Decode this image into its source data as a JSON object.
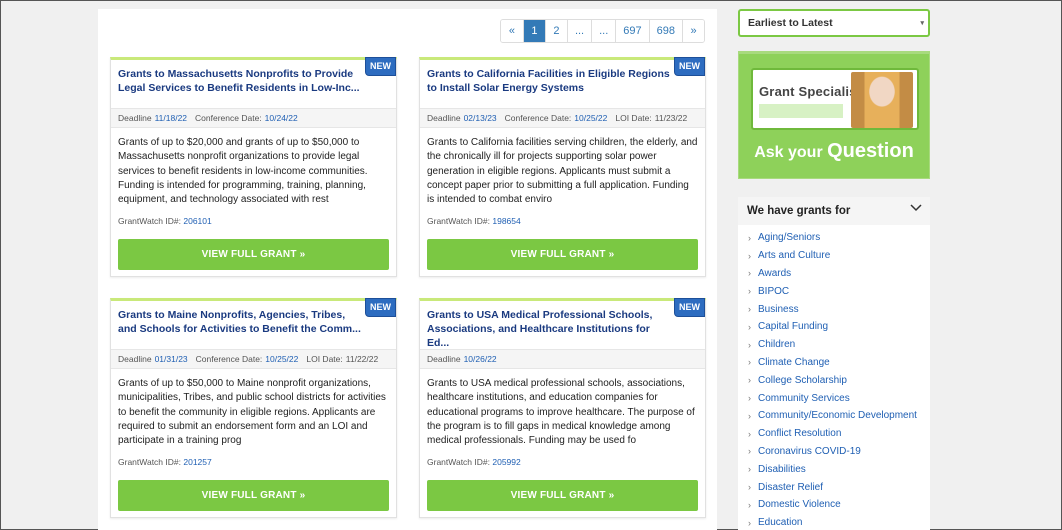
{
  "pagination": {
    "prev": "«",
    "pages": [
      "1",
      "2",
      "...",
      "...",
      "697",
      "698"
    ],
    "next": "»"
  },
  "new_label": "NEW",
  "view_label": "VIEW FULL GRANT »",
  "labels": {
    "deadline": "Deadline",
    "conference": "Conference Date:",
    "loi": "LOI Date:",
    "grantwatch_id": "GrantWatch ID#:"
  },
  "cards": [
    {
      "title": "Grants to Massachusetts Nonprofits to Provide Legal Services to Benefit Residents in Low-Inc...",
      "deadline": "11/18/22",
      "conference": "10/24/22",
      "loi": null,
      "description": "Grants of up to $20,000 and grants of up to $50,000 to Massachusetts nonprofit organizations to provide legal services to benefit residents in low-income communities. Funding is intended for programming, training, planning, equipment, and technology associated with rest",
      "id": "206101"
    },
    {
      "title": "Grants to California Facilities in Eligible Regions to Install Solar Energy Systems",
      "deadline": "02/13/23",
      "conference": "10/25/22",
      "loi": "11/23/22",
      "description": "Grants to California facilities serving children, the elderly, and the chronically ill for projects supporting solar power generation in eligible regions. Applicants must submit a concept paper prior to submitting a full application. Funding is intended to combat enviro",
      "id": "198654"
    },
    {
      "title": "Grants to Maine Nonprofits, Agencies, Tribes, and Schools for Activities to Benefit the Comm...",
      "deadline": "01/31/23",
      "conference": "10/25/22",
      "loi": "11/22/22",
      "description": "Grants of up to $50,000 to Maine nonprofit organizations, municipalities, Tribes, and public school districts for activities to benefit the community in eligible regions. Applicants are required to submit an endorsement form and an LOI and participate in a training prog",
      "id": "201257"
    },
    {
      "title": "Grants to USA Medical Professional Schools, Associations, and Healthcare Institutions for Ed...",
      "deadline": "10/26/22",
      "conference": null,
      "loi": null,
      "description": "Grants to USA medical professional schools, associations, healthcare institutions, and education companies for educational programs to improve healthcare. The purpose of the program is to fill gaps in medical knowledge among medical professionals. Funding may be used fo",
      "id": "205992"
    }
  ],
  "sidebar": {
    "sort_value": "Earliest to Latest",
    "specialist_label": "Grant Specialist",
    "cta_prefix": "Ask your",
    "cta_word": "Question",
    "grants_heading": "We have grants for",
    "categories": [
      "Aging/Seniors",
      "Arts and Culture",
      "Awards",
      "BIPOC",
      "Business",
      "Capital Funding",
      "Children",
      "Climate Change",
      "College Scholarship",
      "Community Services",
      "Community/Economic Development",
      "Conflict Resolution",
      "Coronavirus COVID-19",
      "Disabilities",
      "Disaster Relief",
      "Domestic Violence",
      "Education"
    ]
  },
  "colors": {
    "accent_green": "#7bc843",
    "link_blue": "#1f5fb3",
    "title_navy": "#1a3a80",
    "badge_blue": "#2d6cc0"
  }
}
